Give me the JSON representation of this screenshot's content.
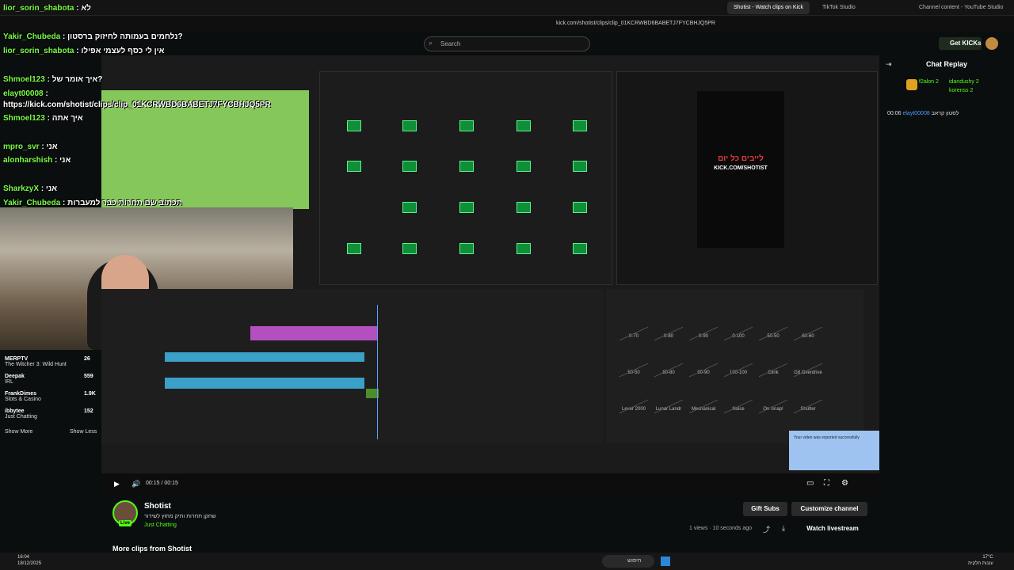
{
  "browser": {
    "tabs": [
      "Shotist - Watch clips on Kick",
      "TikTok Studio",
      "Channel content - YouTube Studio"
    ],
    "url": "kick.com/shotist/clips/clip_01KCRWBD6BABETJ7FYCBHJQ5PR"
  },
  "header": {
    "search_placeholder": "Search",
    "get_kicks": "Get KICKs"
  },
  "chat_overlay": [
    {
      "user": "lior_sorin_shabota",
      "msg": ": לא"
    },
    {
      "user": "Yakir_Chubeda",
      "msg": ": נלחמים בעמותה לחיזוק ברסטון?"
    },
    {
      "user": "lior_sorin_shabota",
      "msg": ": אין לי כסף לעצמי אפילו"
    },
    {
      "user": "Shmoel123",
      "msg": ": איך אומר של?"
    },
    {
      "user": "elayt00008",
      "msg": ":"
    },
    {
      "user": "",
      "msg": "https://kick.com/shotist/clips/clip_01KCRWBD6BABETJ7FYCBHJQ5PR"
    },
    {
      "user": "Shmoel123",
      "msg": ": איך אתה"
    },
    {
      "user": "mpro_svr",
      "msg": ": אני"
    },
    {
      "user": "alonharshish",
      "msg": ": אני"
    },
    {
      "user": "SharkzyX",
      "msg": ": אני"
    },
    {
      "user": "Yakir_Chubeda",
      "msg": ": תכתוב שם תחרות כבר למעברות"
    }
  ],
  "sidebar": {
    "recommended": [
      {
        "name": "MERPTV",
        "sub": "The Witcher 3: Wild Hunt",
        "count": "26"
      },
      {
        "name": "Deepak",
        "sub": "IRL",
        "count": "559"
      },
      {
        "name": "FrankDimes",
        "sub": "Slots & Casino",
        "count": "1.9K"
      },
      {
        "name": "ibbytee",
        "sub": "Just Chatting",
        "count": "152"
      }
    ],
    "show_more": "Show More",
    "show_less": "Show Less"
  },
  "stream": {
    "preview_text_1": "לייבים כל יום",
    "preview_text_2": "KICK.COM/SHOTIST",
    "fx_labels": [
      "0-70",
      "0-80",
      "0-90",
      "0-100",
      "50-50",
      "60-60",
      "50-50",
      "80-80",
      "90-90",
      "100-100",
      "Clink",
      "G8 Overdrive",
      "Lever 2000",
      "Lunar Landr",
      "Mechanical",
      "Noice",
      "On Snap!",
      "Shutter"
    ],
    "toast": "Your video was exported successfully"
  },
  "player": {
    "time": "00:15 / 00:15"
  },
  "channel": {
    "name": "Shotist",
    "tagline": "שחקן תחרות ותיק מחוץ לשידור",
    "category": "Just Chatting",
    "badge": "Live",
    "views": "1 views",
    "ago": "10 seconds ago",
    "gift_subs": "Gift Subs",
    "customize": "Customize channel",
    "watch_livestream": "Watch livestream",
    "more_clips": "More clips from Shotist"
  },
  "chat_replay": {
    "title": "Chat Replay",
    "top_gifters": [
      {
        "name": "f2alon",
        "count": "2"
      },
      {
        "name": "idandushy",
        "count": "2"
      },
      {
        "name": "korenss",
        "count": "2"
      }
    ],
    "message": {
      "time": "00:06",
      "user": "elayt00008",
      "text": "לסטון קראב"
    }
  },
  "taskbar": {
    "time": "16:04",
    "date": "18/12/2025",
    "search": "חיפוש",
    "weather_temp": "17°C",
    "weather_desc": "עננות חלקית"
  }
}
